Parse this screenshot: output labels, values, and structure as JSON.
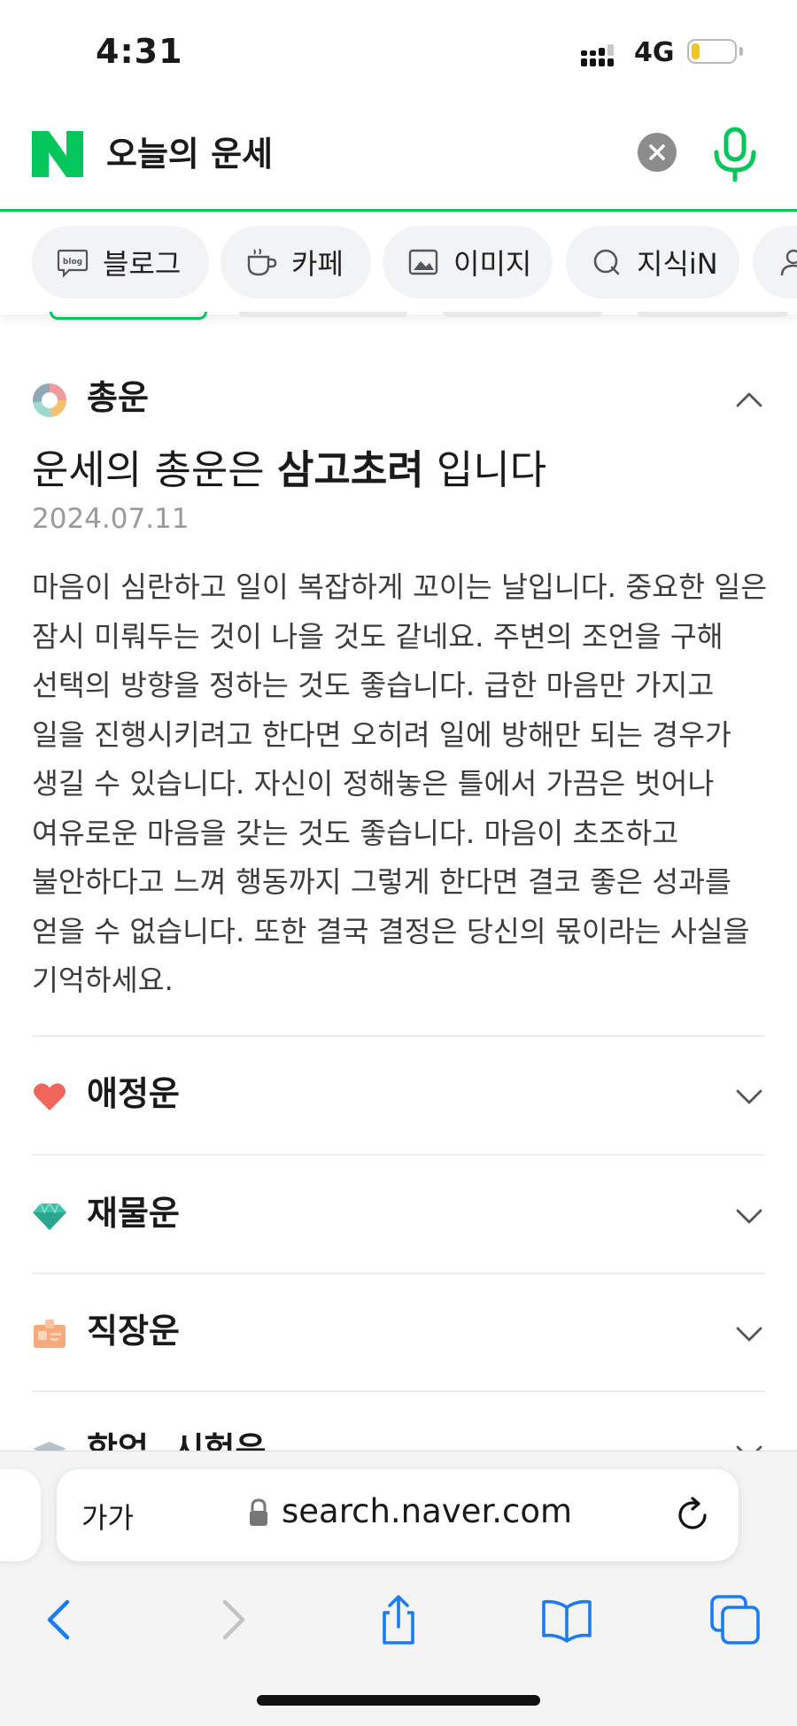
{
  "status_bar": {
    "time": "4:31",
    "network": "4G",
    "battery_fraction": 0.2
  },
  "search": {
    "query": "오늘의 운세"
  },
  "chips": [
    {
      "label": "블로그",
      "icon": "blog-icon"
    },
    {
      "label": "카페",
      "icon": "cup-icon"
    },
    {
      "label": "이미지",
      "icon": "image-icon"
    },
    {
      "label": "지식iN",
      "icon": "question-icon"
    }
  ],
  "fortune": {
    "overall": {
      "title": "총운",
      "headline_prefix": "운세의 총운은 ",
      "headline_keyword": "삼고초려",
      "headline_suffix": " 입니다",
      "date": "2024.07.11",
      "body": "마음이 심란하고 일이 복잡하게 꼬이는 날입니다. 중요한 일은 잠시 미뤄두는 것이 나을 것도 같네요. 주변의 조언을 구해 선택의 방향을 정하는 것도 좋습니다. 급한 마음만 가지고 일을 진행시키려고 한다면 오히려 일에 방해만 되는 경우가 생길 수 있습니다. 자신이 정해놓은 틀에서 가끔은 벗어나 여유로운 마음을 갖는 것도 좋습니다. 마음이 초조하고 불안하다고 느껴 행동까지 그렇게 한다면 결코 좋은 성과를 얻을 수 없습니다. 또한 결국 결정은 당신의 몫이라는 사실을 기억하세요."
    },
    "sections": [
      {
        "title": "애정운",
        "icon": "heart-icon"
      },
      {
        "title": "재물운",
        "icon": "gem-icon"
      },
      {
        "title": "직장운",
        "icon": "id-badge-icon"
      },
      {
        "title": "학업, 시험운",
        "icon": "graduation-cap-icon"
      }
    ]
  },
  "browser": {
    "text_size_label": "가가",
    "url": "search.naver.com"
  },
  "colors": {
    "naver_green": "#03c75a",
    "ios_blue": "#1a7cf4"
  }
}
